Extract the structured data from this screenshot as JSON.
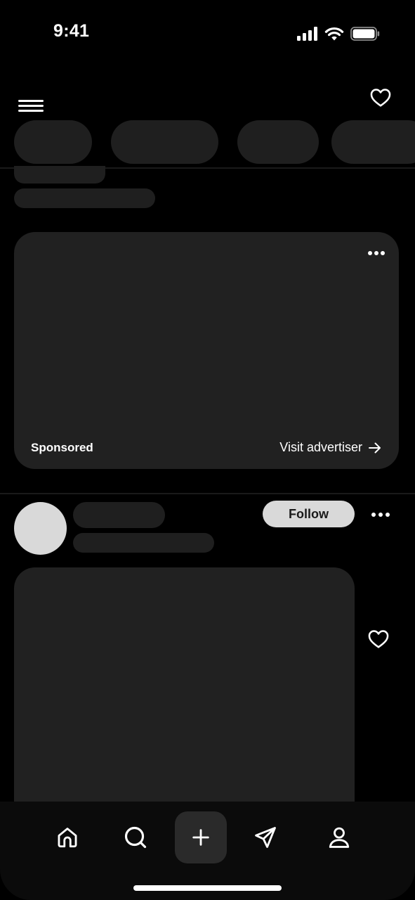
{
  "status_bar": {
    "time": "9:41",
    "icons": [
      "cellular-signal-icon",
      "wifi-icon",
      "battery-icon"
    ]
  },
  "top_bar": {
    "menu_icon": "hamburger-menu-icon",
    "activity_icon": "heart-outline-icon"
  },
  "ad": {
    "sponsored_label": "Sponsored",
    "cta_label": "Visit advertiser",
    "cta_icon": "arrow-right-icon",
    "more_icon": "more-horizontal-icon"
  },
  "post": {
    "follow_label": "Follow",
    "more_icon": "more-horizontal-icon",
    "like_icon": "heart-outline-icon"
  },
  "bottom_nav": {
    "items": [
      {
        "name": "home",
        "icon": "home-icon"
      },
      {
        "name": "search",
        "icon": "search-icon"
      },
      {
        "name": "create",
        "icon": "plus-icon"
      },
      {
        "name": "messages",
        "icon": "paper-plane-icon"
      },
      {
        "name": "profile",
        "icon": "user-icon"
      }
    ]
  },
  "colors": {
    "background": "#000000",
    "surface": "#212121",
    "skeleton": "#1f1f1f",
    "avatar_placeholder": "#d9d9d9",
    "text": "#ffffff"
  }
}
